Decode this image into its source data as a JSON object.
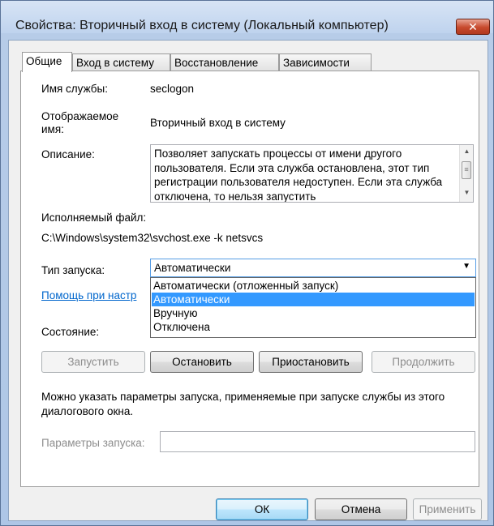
{
  "window": {
    "title": "Свойства: Вторичный вход в систему (Локальный компьютер)",
    "close_label": "✕"
  },
  "tabs": [
    "Общие",
    "Вход в систему",
    "Восстановление",
    "Зависимости"
  ],
  "general": {
    "service_name_label": "Имя службы:",
    "service_name_value": "seclogon",
    "display_name_label": "Отображаемое имя:",
    "display_name_value": "Вторичный вход в систему",
    "description_label": "Описание:",
    "description_value": "Позволяет запускать процессы от имени другого пользователя. Если эта служба остановлена, этот тип регистрации пользователя недоступен. Если эта служба отключена, то нельзя запустить",
    "exe_label": "Исполняемый файл:",
    "exe_value": "C:\\Windows\\system32\\svchost.exe -k netsvcs",
    "startup_type_label": "Тип запуска:",
    "startup_type_value": "Автоматически",
    "startup_options": [
      "Автоматически (отложенный запуск)",
      "Автоматически",
      "Вручную",
      "Отключена"
    ],
    "help_link": "Помощь при настр",
    "status_label": "Состояние:",
    "start_button": "Запустить",
    "stop_button": "Остановить",
    "pause_button": "Приостановить",
    "resume_button": "Продолжить",
    "hint_text": "Можно указать параметры запуска, применяемые при запуске службы из этого диалогового окна.",
    "params_label": "Параметры запуска:",
    "params_value": ""
  },
  "footer": {
    "ok": "ОК",
    "cancel": "Отмена",
    "apply": "Применить"
  }
}
